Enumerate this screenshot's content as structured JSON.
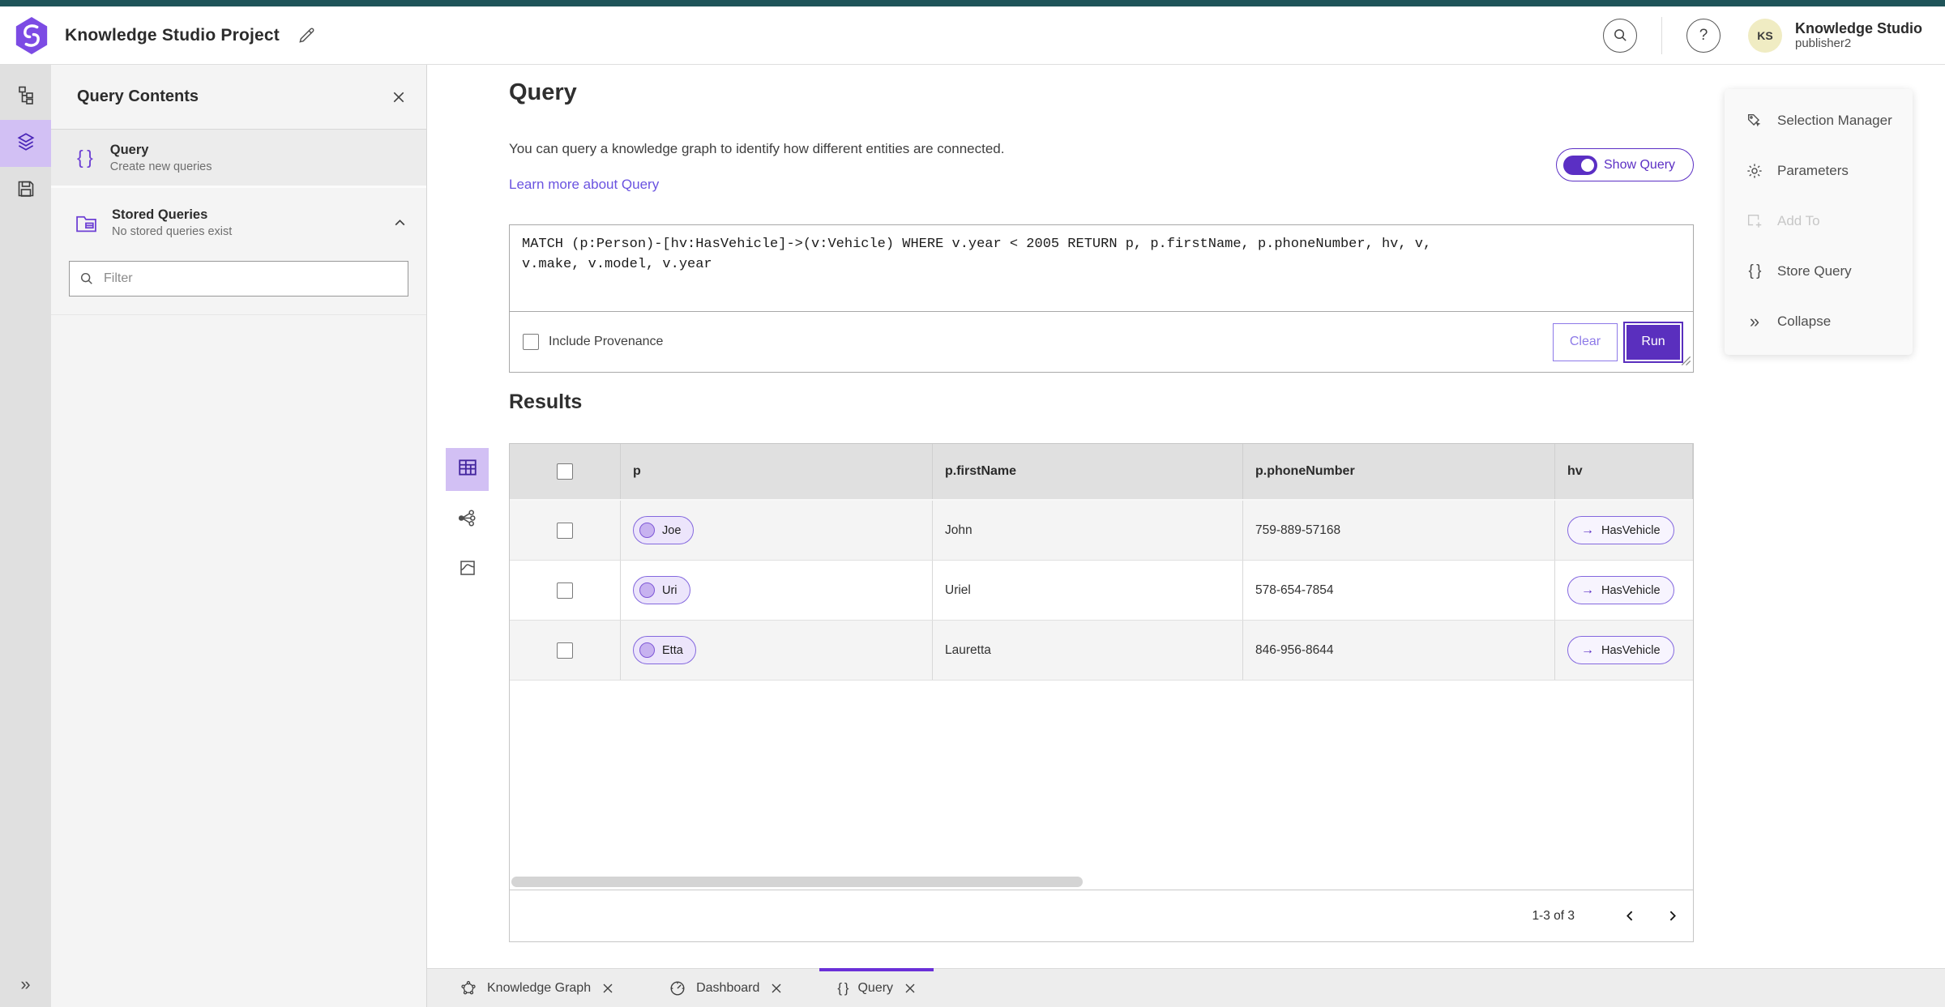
{
  "colors": {
    "top_strip_teal": "#1F5459",
    "accent_purple": "#5B2FC4",
    "light_purple_highlight": "#D2C0F4",
    "link_purple": "#6A53E0",
    "chip_fill": "#ECE5FB",
    "avatar_yellow": "#F0ECC3",
    "panel_gray": "#F4F4F4",
    "table_header_gray": "#E0E0E0"
  },
  "icons": {
    "arrow_right": "→",
    "braces": "{ }",
    "double_chevron": "»"
  },
  "header": {
    "title": "Knowledge Studio Project",
    "account_name": "Knowledge Studio",
    "account_role": "publisher2",
    "avatar_initials": "KS"
  },
  "left_panel": {
    "title": "Query Contents",
    "query_item": {
      "title": "Query",
      "subtitle": "Create new queries"
    },
    "stored_queries": {
      "title": "Stored Queries",
      "subtitle": "No stored queries exist"
    },
    "filter_placeholder": "Filter"
  },
  "query_section": {
    "heading": "Query",
    "description": "You can query a knowledge graph to identify how different entities are connected.",
    "learn_more_link": "Learn more about Query",
    "show_query_label": "Show Query",
    "query_text": "MATCH (p:Person)-[hv:HasVehicle]->(v:Vehicle) WHERE v.year < 2005 RETURN p, p.firstName, p.phoneNumber, hv, v,\nv.make, v.model, v.year",
    "include_provenance_label": "Include Provenance",
    "clear_button": "Clear",
    "run_button": "Run"
  },
  "results": {
    "heading": "Results",
    "columns": [
      "p",
      "p.firstName",
      "p.phoneNumber",
      "hv"
    ],
    "rows": [
      {
        "p": "Joe",
        "firstName": "John",
        "phone": "759-889-57168",
        "hv": "HasVehicle"
      },
      {
        "p": "Uri",
        "firstName": "Uriel",
        "phone": "578-654-7854",
        "hv": "HasVehicle"
      },
      {
        "p": "Etta",
        "firstName": "Lauretta",
        "phone": "846-956-8644",
        "hv": "HasVehicle"
      }
    ],
    "pagination_label": "1-3 of 3"
  },
  "right_menu": {
    "items": [
      {
        "label": "Selection Manager"
      },
      {
        "label": "Parameters"
      },
      {
        "label": "Add To"
      },
      {
        "label": "Store Query"
      },
      {
        "label": "Collapse"
      }
    ]
  },
  "tabs": [
    {
      "label": "Knowledge Graph"
    },
    {
      "label": "Dashboard"
    },
    {
      "label": "Query"
    }
  ]
}
